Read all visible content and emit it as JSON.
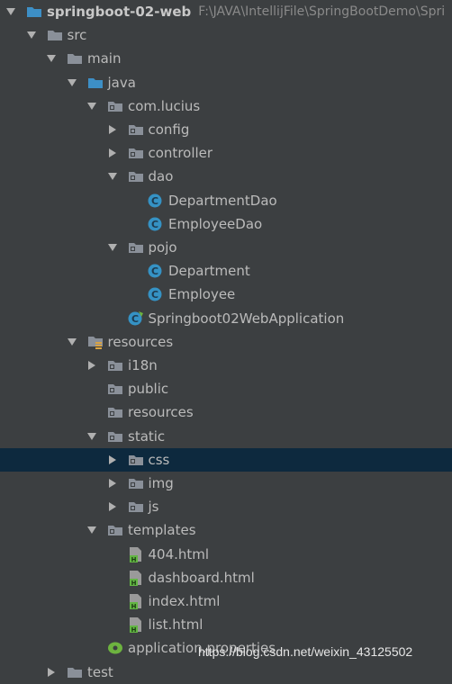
{
  "project": {
    "name": "springboot-02-web",
    "path": "F:\\JAVA\\IntellijFile\\SpringBootDemo\\Spri"
  },
  "tree": [
    {
      "label": "src",
      "expanded": true,
      "icon": "folder"
    },
    {
      "label": "main",
      "expanded": true,
      "icon": "folder"
    },
    {
      "label": "java",
      "expanded": true,
      "icon": "source-folder-blue"
    },
    {
      "label": "com.lucius",
      "expanded": true,
      "icon": "package"
    },
    {
      "label": "config",
      "expanded": false,
      "icon": "package"
    },
    {
      "label": "controller",
      "expanded": false,
      "icon": "package"
    },
    {
      "label": "dao",
      "expanded": true,
      "icon": "package"
    },
    {
      "label": "DepartmentDao",
      "icon": "java-class"
    },
    {
      "label": "EmployeeDao",
      "icon": "java-class"
    },
    {
      "label": "pojo",
      "expanded": true,
      "icon": "package"
    },
    {
      "label": "Department",
      "icon": "java-class"
    },
    {
      "label": "Employee",
      "icon": "java-class"
    },
    {
      "label": "Springboot02WebApplication",
      "icon": "spring-boot-class"
    },
    {
      "label": "resources",
      "expanded": true,
      "icon": "resources-folder"
    },
    {
      "label": "i18n",
      "expanded": false,
      "icon": "package"
    },
    {
      "label": "public",
      "icon": "package"
    },
    {
      "label": "resources",
      "icon": "package"
    },
    {
      "label": "static",
      "expanded": true,
      "icon": "package"
    },
    {
      "label": "css",
      "expanded": false,
      "icon": "package"
    },
    {
      "label": "img",
      "expanded": false,
      "icon": "package"
    },
    {
      "label": "js",
      "expanded": false,
      "icon": "package"
    },
    {
      "label": "templates",
      "expanded": true,
      "icon": "package"
    },
    {
      "label": "404.html",
      "icon": "html-file"
    },
    {
      "label": "dashboard.html",
      "icon": "html-file"
    },
    {
      "label": "index.html",
      "icon": "html-file"
    },
    {
      "label": "list.html",
      "icon": "html-file"
    },
    {
      "label": "application.properties",
      "icon": "properties-file"
    },
    {
      "label": "test",
      "expanded": false,
      "icon": "folder"
    }
  ],
  "selected_item": "css",
  "watermark": "https://blog.csdn.net/weixin_43125502",
  "colors": {
    "background": "#3c3f41",
    "selection": "#0d293e",
    "text": "#bbbbbb",
    "folder": "#8a9099",
    "java_folder": "#3d8fc6",
    "class_icon": "#3592c4",
    "html_icon": "#62b543"
  }
}
